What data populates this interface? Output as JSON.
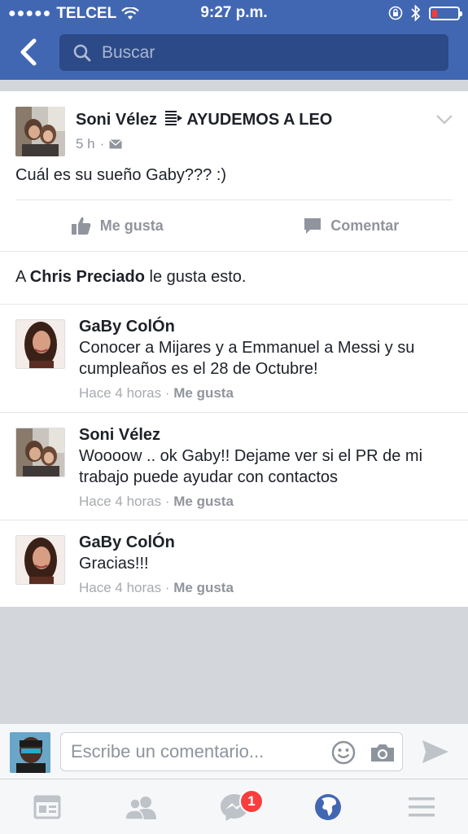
{
  "status_bar": {
    "carrier": "TELCEL",
    "signal_dots": "●●●●●",
    "time": "9:27 p.m."
  },
  "header": {
    "search_placeholder": "Buscar"
  },
  "post": {
    "author": "Soni Vélez\u0000 AYUDEMOS A LEO",
    "author_name": "Soni Vélez",
    "author_suffix": " AYUDEMOS A LEO",
    "time": "5 h",
    "text": "Cuál es su sueño Gaby??? :)",
    "like_label": "Me gusta",
    "comment_label": "Comentar",
    "likes_person": "Chris Preciado",
    "likes_prefix": "A ",
    "likes_suffix": " le gusta esto."
  },
  "comments": [
    {
      "name": "GaBy ColÓn",
      "text": "Conocer a Mijares y a Emmanuel a Messi y su cumpleaños es el 28 de Octubre!",
      "time": "Hace 4 horas",
      "sep": " · ",
      "like": "Me gusta"
    },
    {
      "name": "Soni Vélez",
      "text": "Woooow .. ok Gaby!! Dejame ver si el PR de mi trabajo puede ayudar con contactos",
      "time": "Hace 4 horas",
      "sep": " · ",
      "like": "Me gusta"
    },
    {
      "name": "GaBy ColÓn",
      "text": "Gracias!!!",
      "time": "Hace 4 horas",
      "sep": " · ",
      "like": "Me gusta"
    }
  ],
  "composer": {
    "placeholder": "Escribe un comentario..."
  },
  "tabbar": {
    "messages_badge": "1"
  },
  "colors": {
    "brand_blue": "#4267b2",
    "badge_red": "#fa3e3e",
    "muted_text": "#90949c"
  }
}
